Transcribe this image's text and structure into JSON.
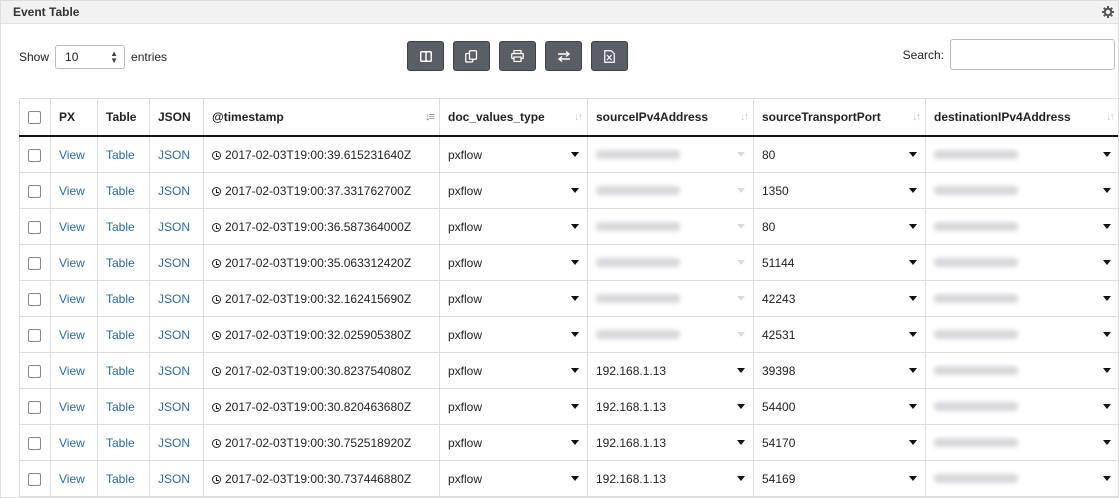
{
  "panel": {
    "title": "Event Table",
    "gear_icon": "gear-icon"
  },
  "length": {
    "show_label": "Show",
    "value": "10",
    "entries_label": "entries"
  },
  "toolbar": {
    "buttons": [
      "columns-icon",
      "copy-icon",
      "print-icon",
      "transpose-icon",
      "excel-icon"
    ]
  },
  "search": {
    "label": "Search:",
    "value": ""
  },
  "table": {
    "columns": [
      "PX",
      "Table",
      "JSON",
      "@timestamp",
      "doc_values_type",
      "sourceIPv4Address",
      "sourceTransportPort",
      "destinationIPv4Address"
    ],
    "rows": [
      {
        "px": "View",
        "table": "Table",
        "json": "JSON",
        "timestamp": "2017-02-03T19:00:39.615231640Z",
        "doc_values_type": "pxflow",
        "sourceIPv4Address": "",
        "sourceTransportPort": "80",
        "destinationIPv4Address": ""
      },
      {
        "px": "View",
        "table": "Table",
        "json": "JSON",
        "timestamp": "2017-02-03T19:00:37.331762700Z",
        "doc_values_type": "pxflow",
        "sourceIPv4Address": "",
        "sourceTransportPort": "1350",
        "destinationIPv4Address": ""
      },
      {
        "px": "View",
        "table": "Table",
        "json": "JSON",
        "timestamp": "2017-02-03T19:00:36.587364000Z",
        "doc_values_type": "pxflow",
        "sourceIPv4Address": "",
        "sourceTransportPort": "80",
        "destinationIPv4Address": ""
      },
      {
        "px": "View",
        "table": "Table",
        "json": "JSON",
        "timestamp": "2017-02-03T19:00:35.063312420Z",
        "doc_values_type": "pxflow",
        "sourceIPv4Address": "",
        "sourceTransportPort": "51144",
        "destinationIPv4Address": ""
      },
      {
        "px": "View",
        "table": "Table",
        "json": "JSON",
        "timestamp": "2017-02-03T19:00:32.162415690Z",
        "doc_values_type": "pxflow",
        "sourceIPv4Address": "",
        "sourceTransportPort": "42243",
        "destinationIPv4Address": ""
      },
      {
        "px": "View",
        "table": "Table",
        "json": "JSON",
        "timestamp": "2017-02-03T19:00:32.025905380Z",
        "doc_values_type": "pxflow",
        "sourceIPv4Address": "",
        "sourceTransportPort": "42531",
        "destinationIPv4Address": ""
      },
      {
        "px": "View",
        "table": "Table",
        "json": "JSON",
        "timestamp": "2017-02-03T19:00:30.823754080Z",
        "doc_values_type": "pxflow",
        "sourceIPv4Address": "192.168.1.13",
        "sourceTransportPort": "39398",
        "destinationIPv4Address": ""
      },
      {
        "px": "View",
        "table": "Table",
        "json": "JSON",
        "timestamp": "2017-02-03T19:00:30.820463680Z",
        "doc_values_type": "pxflow",
        "sourceIPv4Address": "192.168.1.13",
        "sourceTransportPort": "54400",
        "destinationIPv4Address": ""
      },
      {
        "px": "View",
        "table": "Table",
        "json": "JSON",
        "timestamp": "2017-02-03T19:00:30.752518920Z",
        "doc_values_type": "pxflow",
        "sourceIPv4Address": "192.168.1.13",
        "sourceTransportPort": "54170",
        "destinationIPv4Address": ""
      },
      {
        "px": "View",
        "table": "Table",
        "json": "JSON",
        "timestamp": "2017-02-03T19:00:30.737446880Z",
        "doc_values_type": "pxflow",
        "sourceIPv4Address": "192.168.1.13",
        "sourceTransportPort": "54169",
        "destinationIPv4Address": ""
      }
    ]
  }
}
